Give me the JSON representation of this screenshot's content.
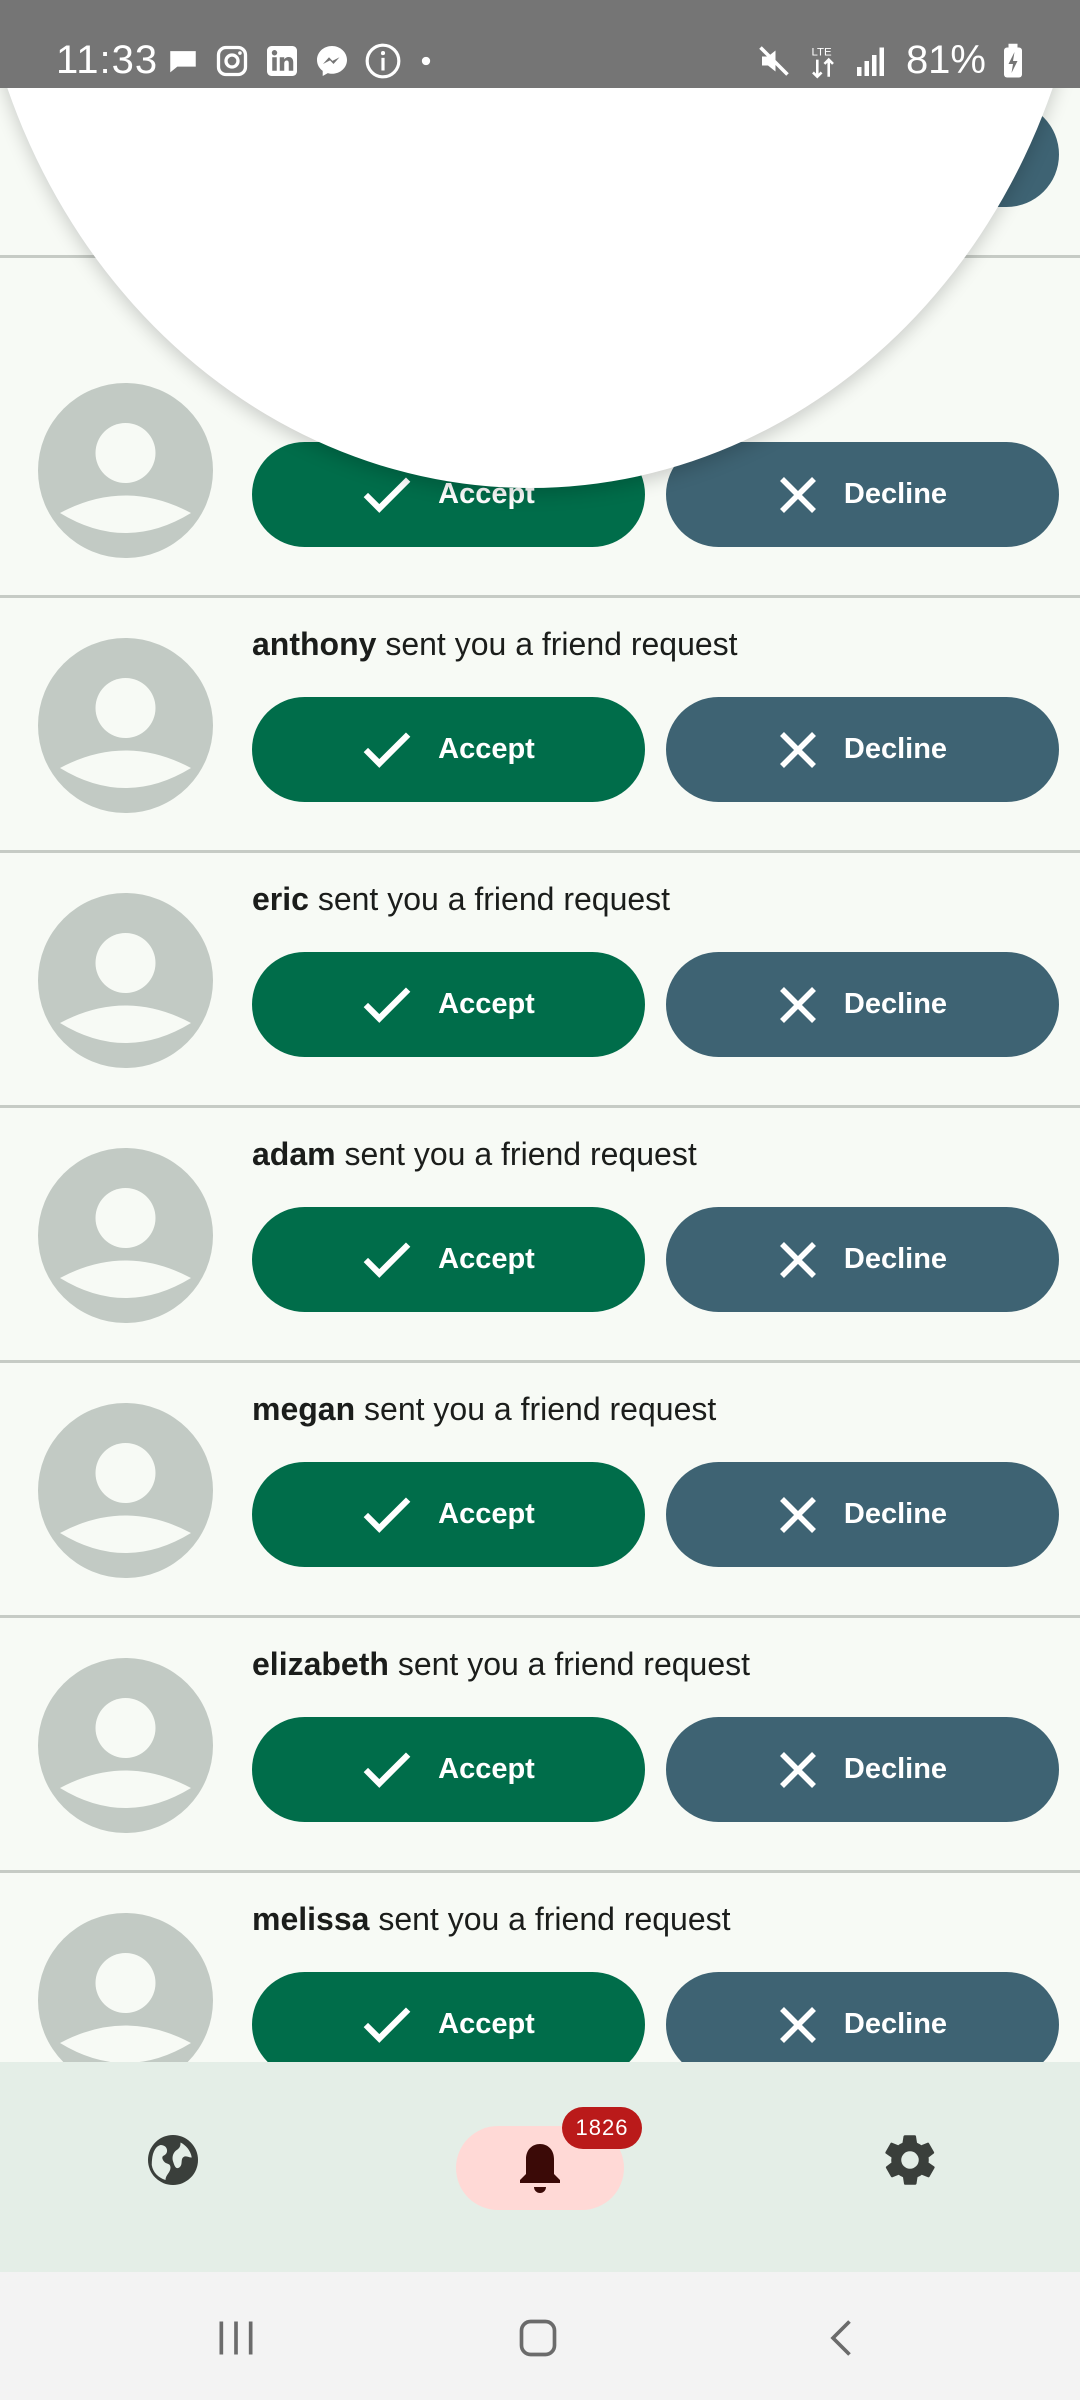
{
  "status_bar": {
    "time": "11:33",
    "battery": "81%",
    "left_icons": [
      "chat-bubble-icon",
      "instagram-icon",
      "linkedin-icon",
      "messenger-icon",
      "info-icon",
      "dot-icon"
    ],
    "right_icons": [
      "mute-icon",
      "lte-data-icon",
      "signal-icon",
      "battery-charging-icon"
    ]
  },
  "requests": {
    "suffix": " sent you a friend request",
    "accept_label": "Accept",
    "decline_label": "Decline",
    "items": [
      {
        "name": ""
      },
      {
        "name": ""
      },
      {
        "name": "anthony"
      },
      {
        "name": "eric"
      },
      {
        "name": "adam"
      },
      {
        "name": "megan"
      },
      {
        "name": "elizabeth"
      },
      {
        "name": "melissa"
      }
    ]
  },
  "bottom_nav": {
    "items": [
      {
        "icon": "globe-icon"
      },
      {
        "icon": "bell-icon",
        "badge": "1826",
        "active": true
      },
      {
        "icon": "gear-icon"
      }
    ]
  },
  "system_nav": {
    "items": [
      "recents-icon",
      "home-icon",
      "back-icon"
    ]
  },
  "colors": {
    "accept": "#006d4a",
    "decline": "#3e6373",
    "badge": "#ba1a1a",
    "avatar": "#c2cac4"
  }
}
